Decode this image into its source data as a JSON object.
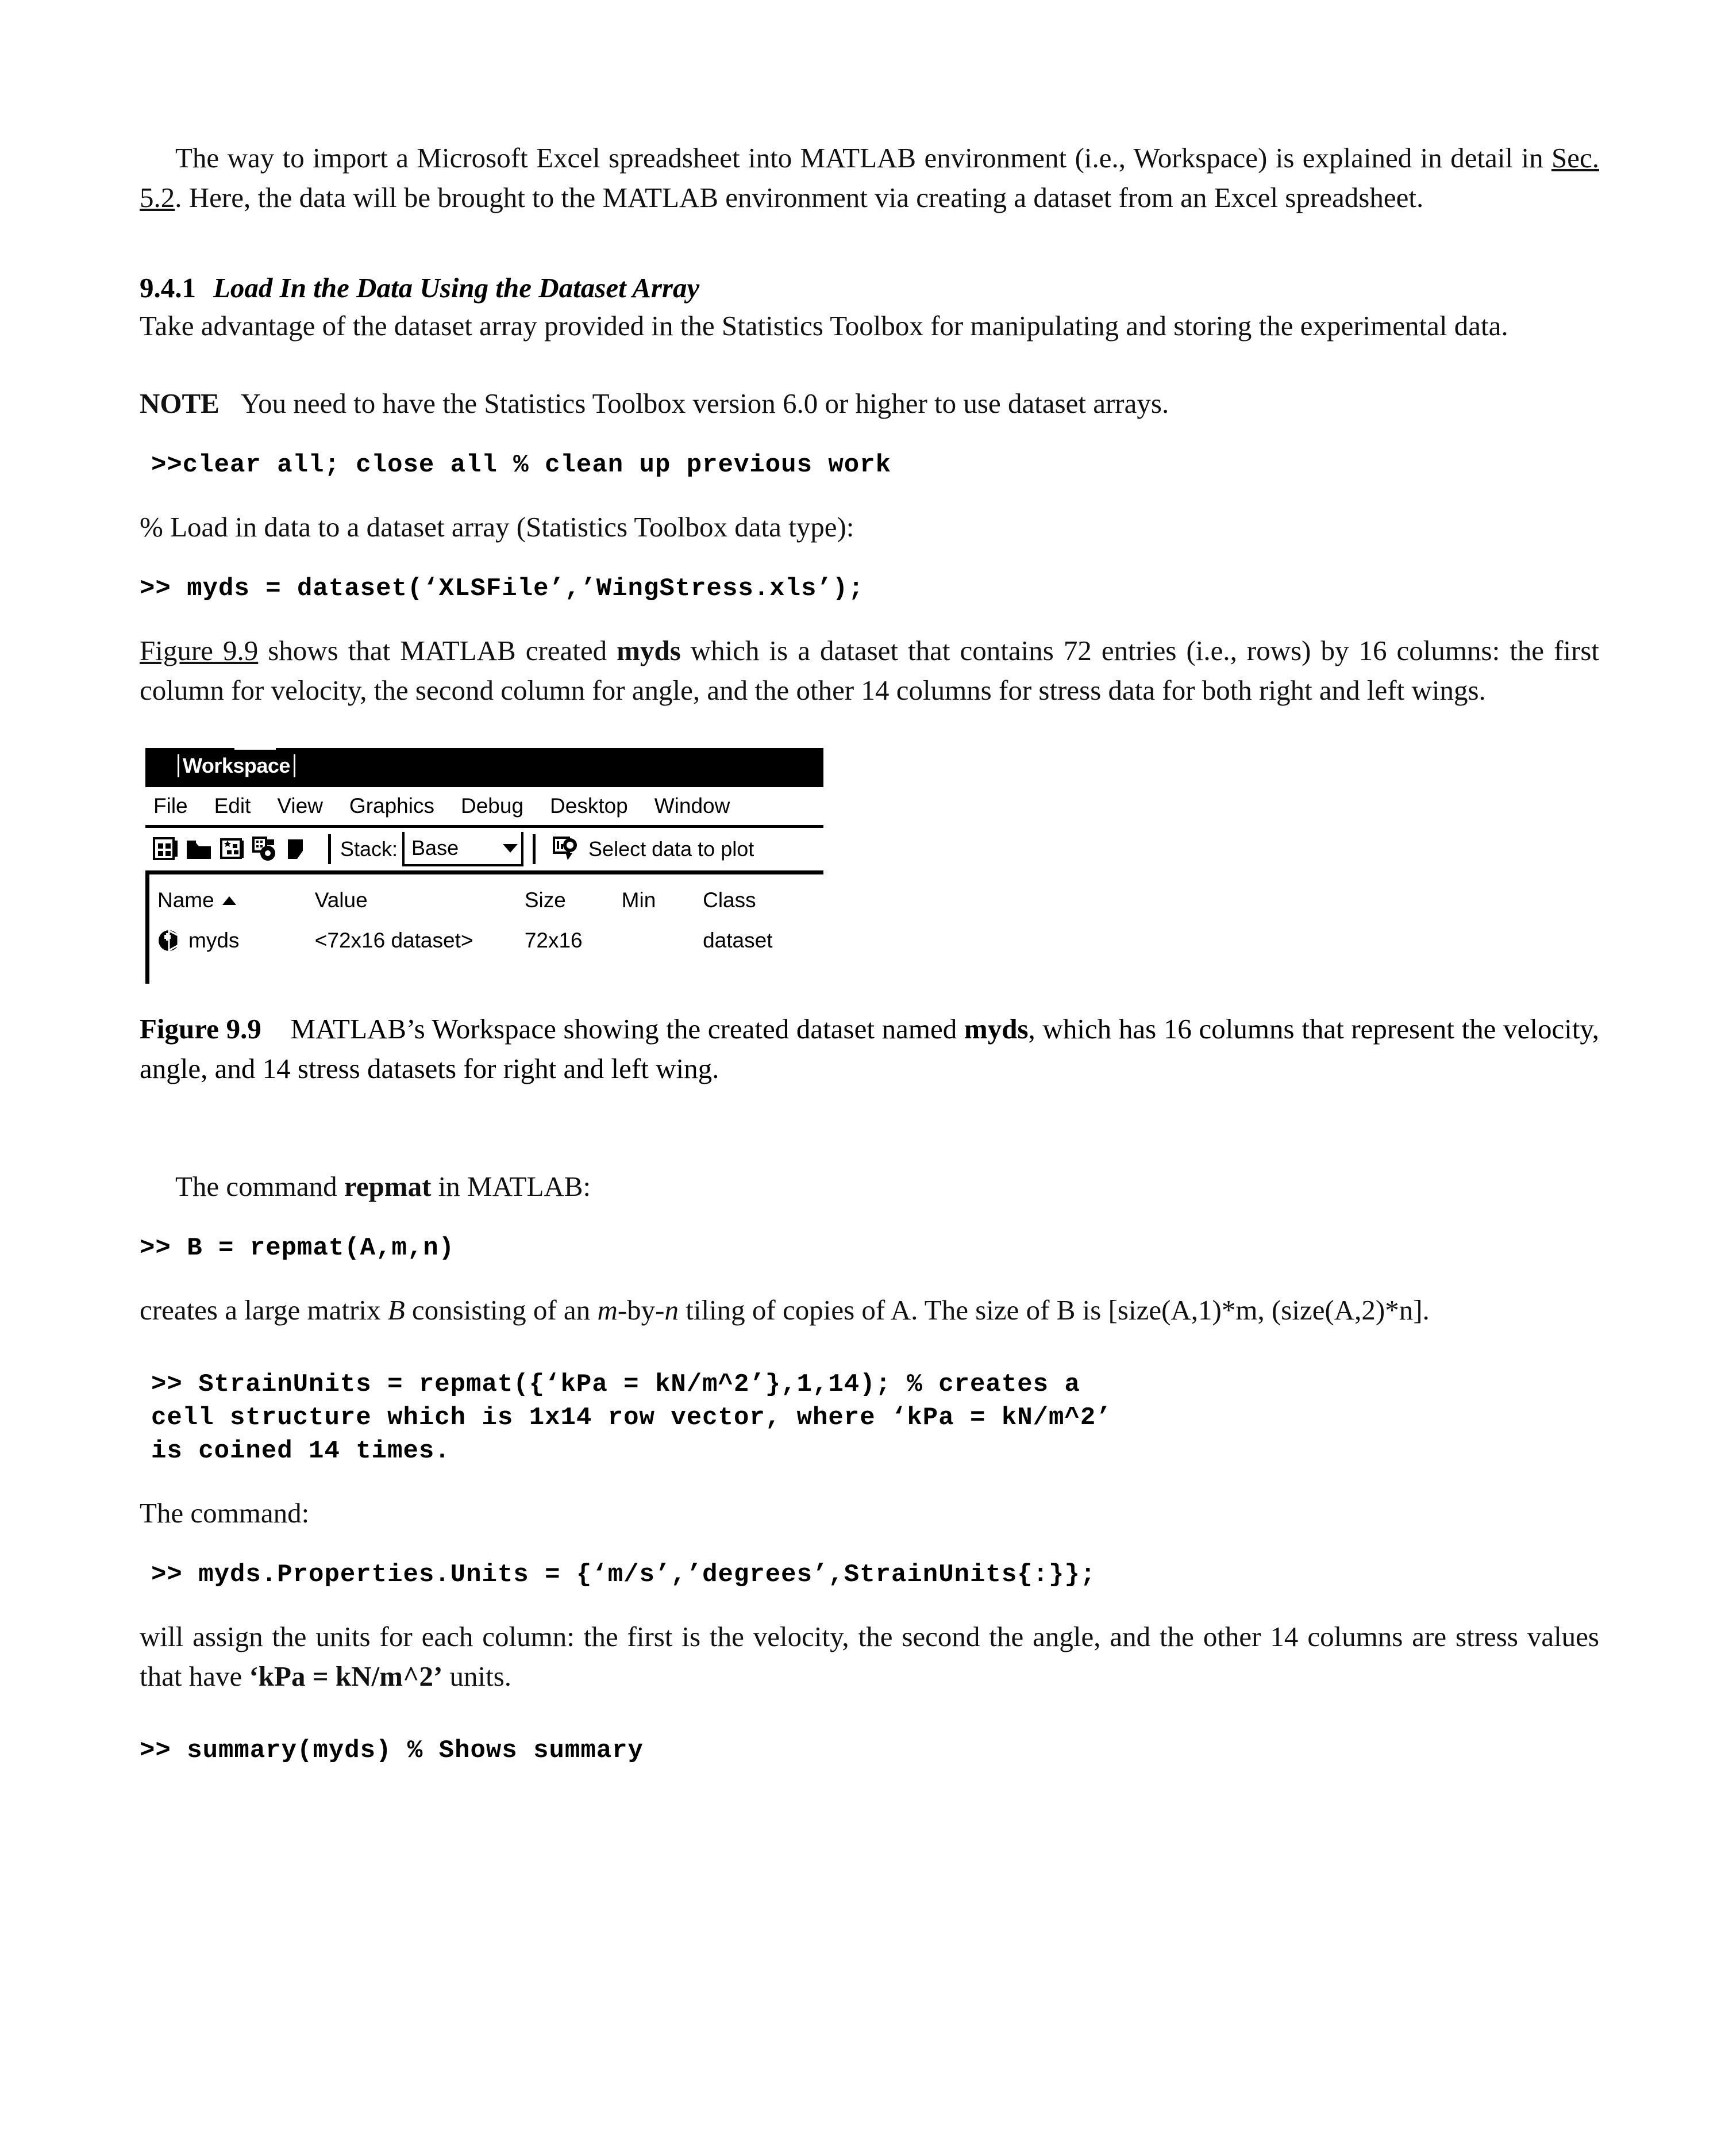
{
  "document": {
    "paragraphs": {
      "intro": {
        "lead": "The way to import a Microsoft Excel spreadsheet into MATLAB environment (i.e., Workspace) is explained in detail in ",
        "ref": "Sec. 5.2",
        "tail": ". Here, the data will be brought to the MATLAB environment via creating a dataset from an Excel spreadsheet."
      },
      "section_body": "Take advantage of the dataset array provided in the Statistics Toolbox for manipulating and storing the experimental data.",
      "note_label": "NOTE",
      "note_text": "You need to have the Statistics Toolbox version 6.0 or higher to use dataset arrays.",
      "comment_load": "% Load in data to a dataset array (Statistics Toolbox data type):",
      "fig_ref_para": {
        "ref": "Figure 9.9",
        "part1": " shows that MATLAB created ",
        "mono": "myds",
        "part2": " which is a dataset that contains 72 entries (i.e., rows) by 16 columns: the first column for velocity, the second column for angle, and the other 14 columns for stress data for both right and left wings."
      },
      "repmat_lead": {
        "part1": "The command ",
        "cmd": "repmat",
        "part2": " in MATLAB:"
      },
      "repmat_desc": {
        "part1": "creates a large matrix ",
        "var_b": "B",
        "part2": " consisting of an ",
        "mby": "m",
        "part3": "-by-",
        "nby": "n",
        "part4": " tiling of copies of A. The size of B is [size(A,1)*m, (size(A,2)*n]."
      },
      "command_lead": "The command:",
      "units_desc": {
        "part1": "will assign the units for each column: the first is the velocity, the second the angle, and the other 14 columns are stress values that have ",
        "bold": "‘kPa = kN/m^2’",
        "part2": " units."
      }
    },
    "section": {
      "number": "9.4.1",
      "title": "Load In the Data Using the Dataset Array"
    },
    "code": {
      "clear_all": ">>clear all; close all % clean up previous work",
      "dataset_create": ">> myds = dataset(‘XLSFile’,’WingStress.xls’);",
      "repmat_syntax": ">> B = repmat(A,m,n)",
      "strain_units_l1": ">> StrainUnits = repmat({‘kPa = kN/m^2’},1,14); % creates a",
      "strain_units_l2": "cell structure which is 1x14 row vector, where ‘kPa = kN/m^2’",
      "strain_units_l3": "is coined 14 times.",
      "properties_units": ">> myds.Properties.Units = {‘m/s’,’degrees’,StrainUnits{:}};",
      "summary": ">> summary(myds) % Shows summary"
    },
    "figure": {
      "caption": {
        "label": "Figure 9.9",
        "part1": "MATLAB’s Workspace showing the created dataset named  ",
        "mono": "myds",
        "part2": ", which has 16 columns that represent the velocity, angle, and 14 stress datasets for right and left wing."
      },
      "window": {
        "title": "Workspace",
        "menu": [
          "File",
          "Edit",
          "View",
          "Graphics",
          "Debug",
          "Desktop",
          "Window"
        ],
        "toolbar": {
          "icons": [
            "new-variable-icon",
            "open-folder-icon",
            "import-data-icon",
            "copy-paste-icon",
            "delete-variable-icon"
          ],
          "stack_label": "Stack:",
          "stack_value": "Base",
          "plot_icon": "plot-selector-icon",
          "plot_label": "Select data to plot"
        },
        "table": {
          "columns": [
            "Name",
            "Value",
            "Size",
            "Min",
            "Class"
          ],
          "sorted_column": "Name",
          "rows": [
            {
              "icon": "dataset-variable-icon",
              "name": "myds",
              "value": "<72x16 dataset>",
              "size": "72x16",
              "min": "",
              "class": "dataset"
            }
          ]
        }
      }
    },
    "colors": {
      "text": "#000000",
      "background": "#ffffff",
      "titlebar": "#000000",
      "titlebar_text": "#ffffff"
    }
  }
}
